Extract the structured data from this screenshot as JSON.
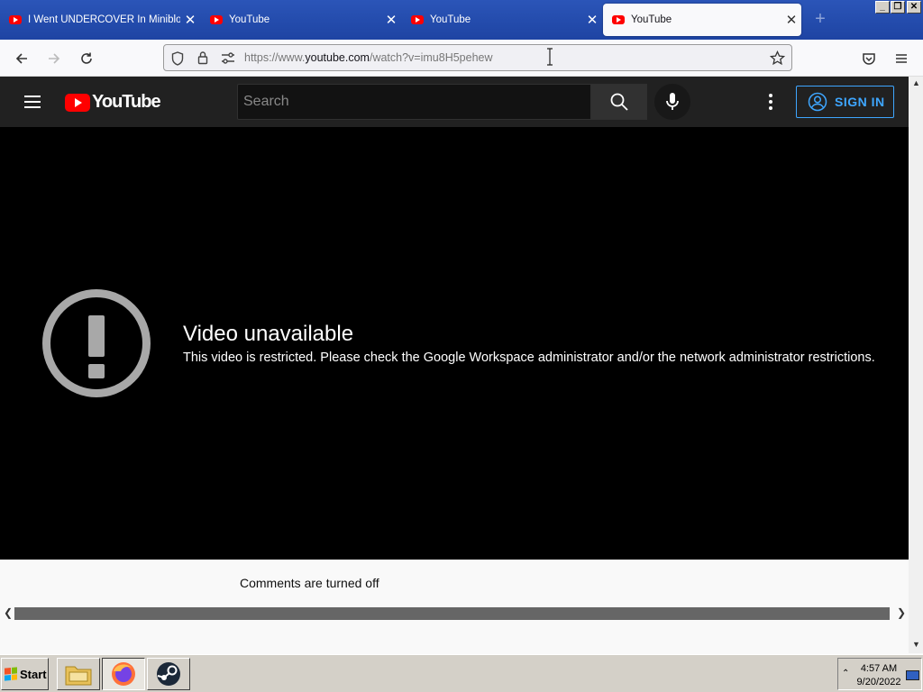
{
  "browser": {
    "tabs": [
      {
        "title": "I Went UNDERCOVER In Minibloxia",
        "active": false
      },
      {
        "title": "YouTube",
        "active": false
      },
      {
        "title": "YouTube",
        "active": false
      },
      {
        "title": "YouTube",
        "active": true
      }
    ],
    "url_prefix": "https://www.",
    "url_domain": "youtube.com",
    "url_path": "/watch?v=imu8H5pehew"
  },
  "youtube": {
    "logo_text": "YouTube",
    "search_placeholder": "Search",
    "sign_in_label": "SIGN IN"
  },
  "player": {
    "error_title": "Video unavailable",
    "error_message": "This video is restricted. Please check the Google Workspace administrator and/or the network administrator restrictions."
  },
  "comments_status": "Comments are turned off",
  "taskbar": {
    "start_label": "Start",
    "apps": [
      "file-explorer-icon",
      "firefox-icon",
      "steam-icon"
    ],
    "time": "4:57 AM",
    "date": "9/20/2022"
  },
  "colors": {
    "tabstrip": "#2b55b8",
    "youtube_red": "#ff0000",
    "header_bg": "#212121",
    "sign_in_blue": "#3ea6ff"
  }
}
